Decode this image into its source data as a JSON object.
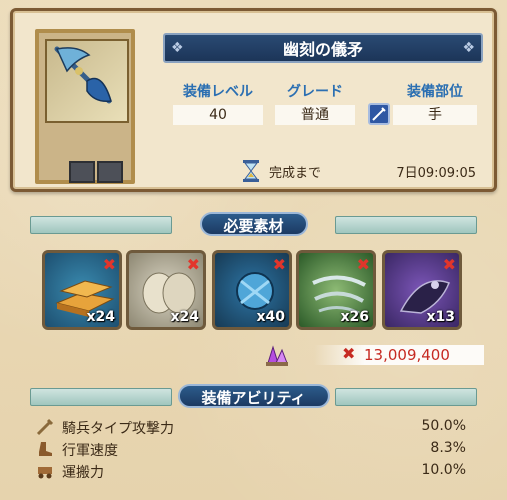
{
  "item": {
    "name": "幽刻の儀矛",
    "stats": [
      {
        "label": "装備レベル",
        "value": "40"
      },
      {
        "label": "グレード",
        "value": "普通"
      },
      {
        "label": "装備部位",
        "value": "手"
      }
    ],
    "complete_label": "完成まで",
    "complete_time": "7日09:09:05",
    "icon": "spear-icon"
  },
  "materials_header": "必要素材",
  "materials": [
    {
      "qty": "x24",
      "icon": "gold-ingot-icon"
    },
    {
      "qty": "x24",
      "icon": "cloth-bundle-icon"
    },
    {
      "qty": "x40",
      "icon": "blue-crystal-cluster-icon"
    },
    {
      "qty": "x26",
      "icon": "green-shards-icon"
    },
    {
      "qty": "x13",
      "icon": "purple-creature-icon"
    }
  ],
  "cost": {
    "value": "13,009,400",
    "icon": "purple-crystal-icon"
  },
  "abilities_header": "装備アビリティ",
  "abilities": [
    {
      "name": "騎兵タイプ攻撃力",
      "value": "50.0%",
      "icon": "sword-icon"
    },
    {
      "name": "行軍速度",
      "value": "8.3%",
      "icon": "boot-icon"
    },
    {
      "name": "運搬力",
      "value": "10.0%",
      "icon": "cart-icon"
    }
  ],
  "colors": {
    "accent_blue": "#2b6fb2",
    "cost_red": "#c62a22",
    "frame_brown": "#7c5a34"
  }
}
